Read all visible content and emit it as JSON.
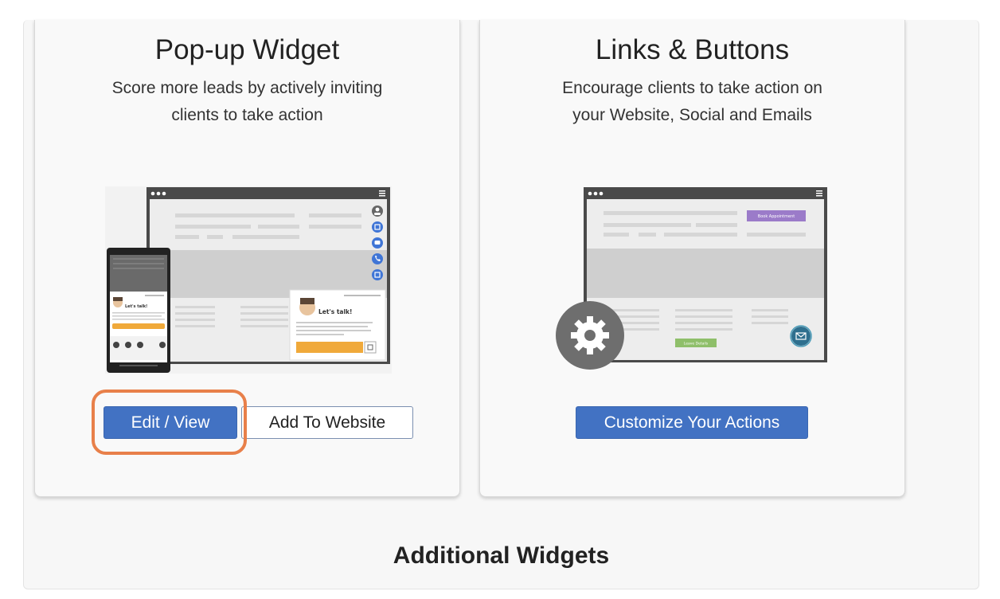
{
  "cards": [
    {
      "title": "Pop-up Widget",
      "description_lines": [
        "Score more leads by actively inviting",
        "clients to take action"
      ],
      "buttons": {
        "primary": "Edit / View",
        "secondary": "Add To Website"
      },
      "illustration": {
        "popup_heading": "Let's talk!",
        "phone_heading": "Let's talk!"
      }
    },
    {
      "title": "Links & Buttons",
      "description_lines": [
        "Encourage clients to take action on",
        "your Website, Social and Emails"
      ],
      "buttons": {
        "primary": "Customize Your Actions"
      },
      "illustration": {
        "top_button": "Book Appointment",
        "bottom_button": "Leave Details"
      }
    }
  ],
  "section_title": "Additional Widgets",
  "colors": {
    "primary_button": "#4272c3",
    "highlight": "#e8804a",
    "accent_orange": "#f0a93a",
    "accent_purple": "#9b7bc9",
    "accent_green": "#8fbf6a"
  },
  "icons": [
    "settings-gear-icon",
    "chat-icon",
    "phone-icon",
    "calendar-icon",
    "user-icon",
    "mail-icon"
  ]
}
